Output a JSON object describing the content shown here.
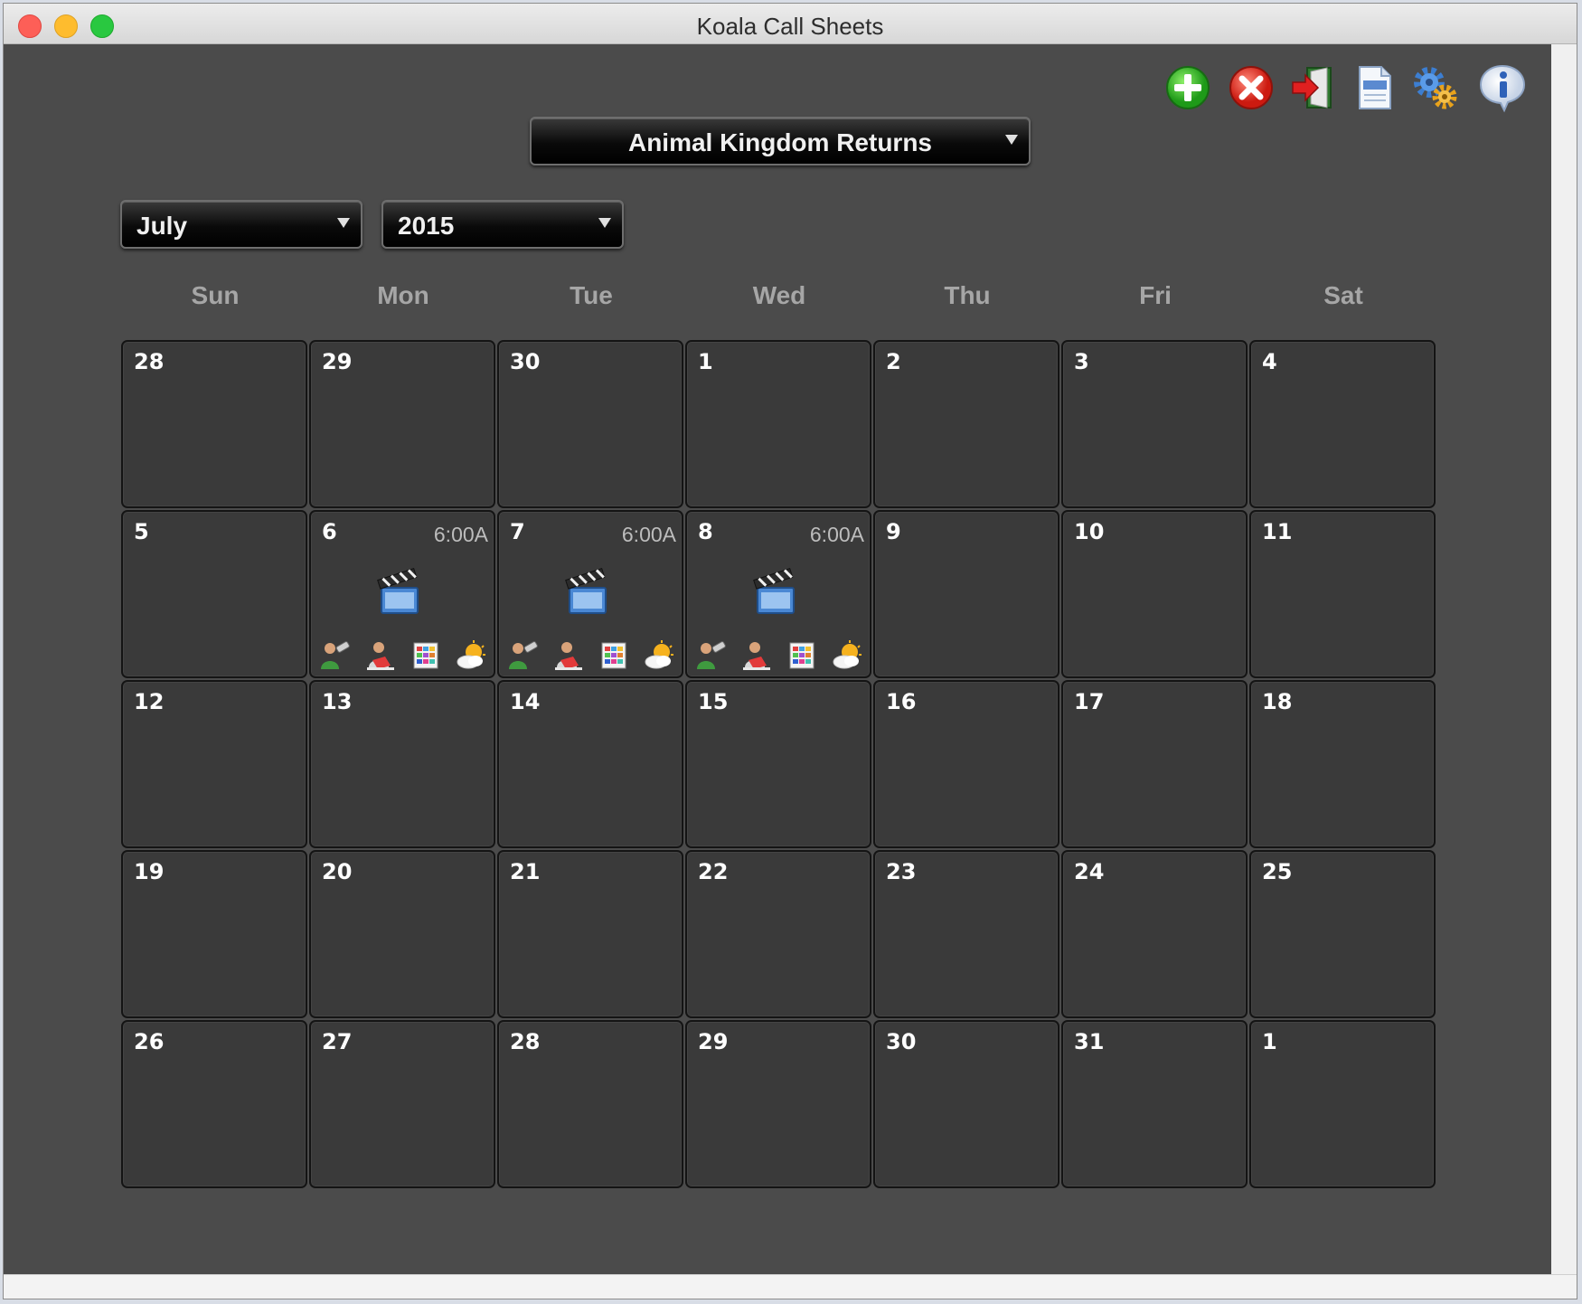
{
  "window": {
    "title": "Koala Call Sheets"
  },
  "toolbar": {
    "icons": [
      "add-icon",
      "delete-icon",
      "exit-icon",
      "document-icon",
      "settings-icon",
      "info-icon"
    ]
  },
  "project_select": {
    "value": "Animal Kingdom Returns"
  },
  "month_select": {
    "value": "July"
  },
  "year_select": {
    "value": "2015"
  },
  "weekdays": [
    "Sun",
    "Mon",
    "Tue",
    "Wed",
    "Thu",
    "Fri",
    "Sat"
  ],
  "calendar": {
    "weeks": [
      [
        {
          "day": "28"
        },
        {
          "day": "29"
        },
        {
          "day": "30"
        },
        {
          "day": "1"
        },
        {
          "day": "2"
        },
        {
          "day": "3"
        },
        {
          "day": "4"
        }
      ],
      [
        {
          "day": "5"
        },
        {
          "day": "6",
          "call_time": "6:00A",
          "has_shoot": true
        },
        {
          "day": "7",
          "call_time": "6:00A",
          "has_shoot": true
        },
        {
          "day": "8",
          "call_time": "6:00A",
          "has_shoot": true
        },
        {
          "day": "9"
        },
        {
          "day": "10"
        },
        {
          "day": "11"
        }
      ],
      [
        {
          "day": "12"
        },
        {
          "day": "13"
        },
        {
          "day": "14"
        },
        {
          "day": "15"
        },
        {
          "day": "16"
        },
        {
          "day": "17"
        },
        {
          "day": "18"
        }
      ],
      [
        {
          "day": "19"
        },
        {
          "day": "20"
        },
        {
          "day": "21"
        },
        {
          "day": "22"
        },
        {
          "day": "23"
        },
        {
          "day": "24"
        },
        {
          "day": "25"
        }
      ],
      [
        {
          "day": "26"
        },
        {
          "day": "27"
        },
        {
          "day": "28"
        },
        {
          "day": "29"
        },
        {
          "day": "30"
        },
        {
          "day": "31"
        },
        {
          "day": "1"
        }
      ]
    ]
  },
  "shoot_day_icons": [
    "clapperboard-icon",
    "crew-icon",
    "cast-icon",
    "schedule-icon",
    "weather-icon"
  ]
}
